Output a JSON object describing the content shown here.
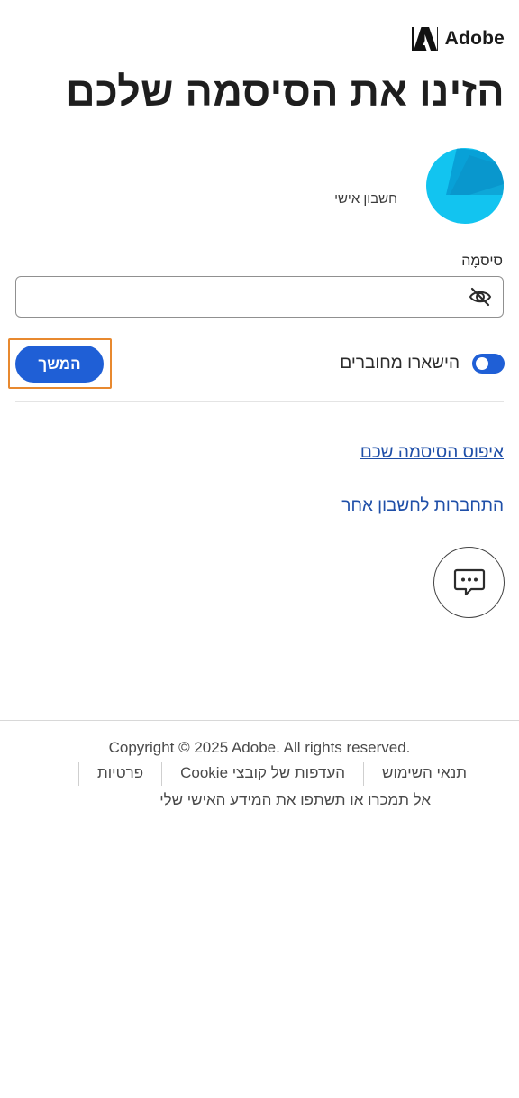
{
  "brand": {
    "name": "Adobe",
    "logo_icon": "adobe-logo-icon"
  },
  "page": {
    "title": "הזינו את הסיסמה שלכם"
  },
  "account": {
    "label": "חשבון אישי",
    "avatar_color": "#12c4f0"
  },
  "password": {
    "label": "סיסמָה",
    "value": "",
    "placeholder": "",
    "toggle_icon": "eye-off-icon"
  },
  "stay_signed_in": {
    "label": "הישארו מחוברים",
    "enabled": true
  },
  "continue_button": {
    "label": "המשך"
  },
  "links": {
    "reset_password": "איפוס הסיסמה שכם",
    "other_account": "התחברות לחשבון אחר"
  },
  "chat": {
    "icon": "chat-bubble-icon"
  },
  "footer": {
    "copyright": "Copyright © 2025 Adobe. All rights reserved.",
    "links": [
      "תנאי השימוש",
      "העדפות של קובצי Cookie",
      "פרטיות",
      "אל תמכרו או תשתפו את המידע האישי שלי"
    ]
  },
  "colors": {
    "accent": "#1f5fd6",
    "link": "#1f4fa8",
    "focus_outline": "#e8892f"
  }
}
